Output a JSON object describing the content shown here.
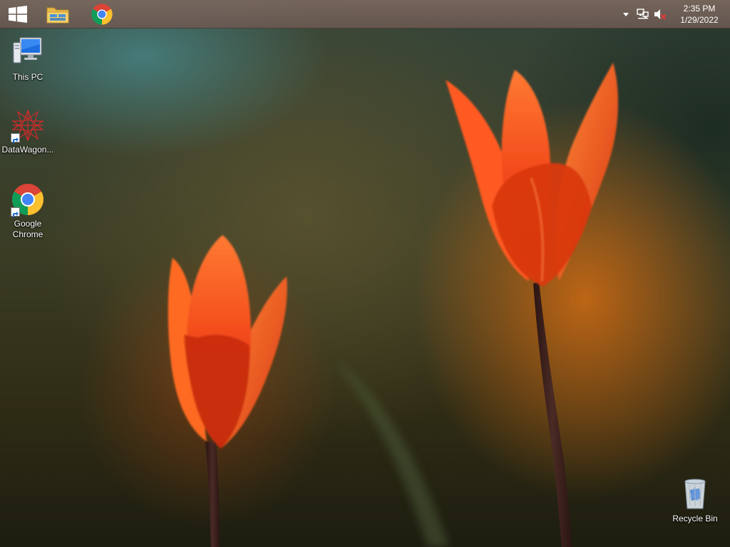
{
  "taskbar": {
    "start_icon": "windows-logo-icon",
    "pinned": [
      {
        "name": "File Explorer",
        "icon": "folder-icon"
      },
      {
        "name": "Google Chrome",
        "icon": "chrome-icon"
      }
    ],
    "tray": {
      "overflow_icon": "caret-up-icon",
      "network_icon": "network-icon",
      "volume_icon": "volume-muted-icon",
      "time": "2:35 PM",
      "date": "1/29/2022"
    }
  },
  "desktop": {
    "icons": [
      {
        "label": "This PC",
        "icon": "computer-icon"
      },
      {
        "label": "DataWagon...",
        "icon": "datawagon-icon",
        "shortcut": true
      },
      {
        "label": "Google\nChrome",
        "icon": "chrome-icon",
        "shortcut": true
      },
      {
        "label": "Recycle Bin",
        "icon": "recycle-bin-icon"
      }
    ]
  },
  "colors": {
    "taskbar": "#735f56",
    "accent_orange": "#ff5a10",
    "tulip_red": "#e8360e"
  }
}
